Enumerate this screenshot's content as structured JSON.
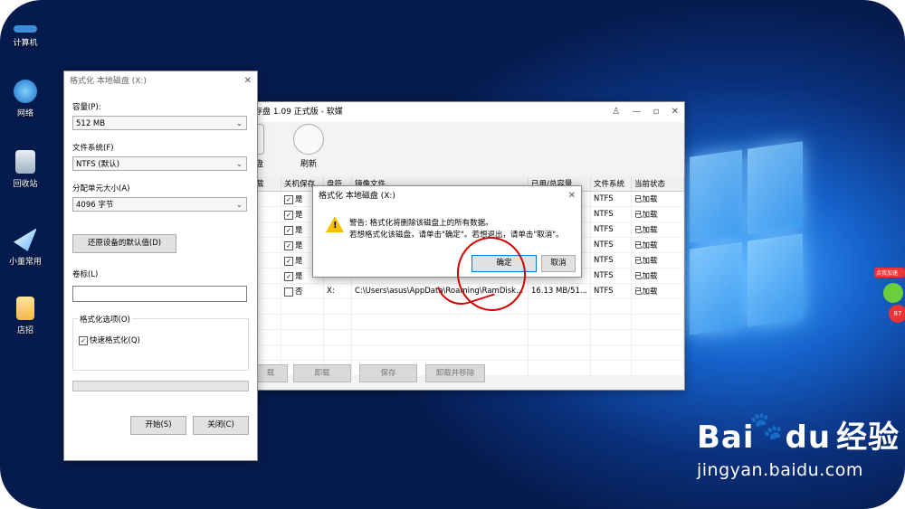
{
  "desktop": {
    "icons": [
      {
        "label": "计算机"
      },
      {
        "label": "网络"
      },
      {
        "label": "回收站"
      },
      {
        "label": "小董常用"
      },
      {
        "label": "店招"
      }
    ],
    "widget_label": "点我加速",
    "widget_value": "87"
  },
  "watermark": {
    "brand": "Bai",
    "brand2": "du",
    "brand_cn": "经验",
    "url": "jingyan.baidu.com"
  },
  "ramdisk": {
    "title": "内存盘 1.09 正式版 - 软媒",
    "toolbar": [
      {
        "label": "存盘"
      },
      {
        "label": "刷新"
      }
    ],
    "columns": [
      "载",
      "关机保存",
      "盘符",
      "镜像文件",
      "已用/总容量",
      "文件系统",
      "当前状态"
    ],
    "rows": [
      {
        "save": "是",
        "letter": "",
        "file": "",
        "used": "",
        "fs": "NTFS",
        "state": "已加载",
        "checked": true
      },
      {
        "save": "是",
        "letter": "",
        "file": "",
        "used": "",
        "fs": "NTFS",
        "state": "已加载",
        "checked": true
      },
      {
        "save": "是",
        "letter": "",
        "file": "",
        "used": "",
        "fs": "NTFS",
        "state": "已加载",
        "checked": true
      },
      {
        "save": "是",
        "letter": "",
        "file": "",
        "used": "",
        "fs": "NTFS",
        "state": "已加载",
        "checked": true
      },
      {
        "save": "是",
        "letter": "",
        "file": "",
        "used": "",
        "fs": "NTFS",
        "state": "已加载",
        "checked": true
      },
      {
        "save": "是",
        "letter": "",
        "file": "",
        "used": "",
        "fs": "NTFS",
        "state": "已加载",
        "checked": true
      },
      {
        "save": "否",
        "letter": "X:",
        "file": "C:\\Users\\asus\\AppData\\Roaming\\RamDisk...",
        "used": "16.13 MB/51...",
        "fs": "NTFS",
        "state": "已加载",
        "checked": false
      }
    ],
    "buttons": [
      "载",
      "卸载",
      "保存",
      "卸载并移除"
    ]
  },
  "format": {
    "title": "格式化 本地磁盘 (X:)",
    "capacity_label": "容量(P):",
    "capacity_value": "512 MB",
    "fs_label": "文件系统(F)",
    "fs_value": "NTFS (默认)",
    "unit_label": "分配单元大小(A)",
    "unit_value": "4096 字节",
    "restore_button": "还原设备的默认值(D)",
    "volume_label": "卷标(L)",
    "volume_value": "",
    "options_label": "格式化选项(O)",
    "quick_format": "快速格式化(Q)",
    "start_button": "开始(S)",
    "close_button": "关闭(C)"
  },
  "confirm": {
    "title": "格式化 本地磁盘 (X:)",
    "line1": "警告: 格式化将删除该磁盘上的所有数据。",
    "line2": "若想格式化该磁盘，请单击\"确定\"。若想退出，请单击\"取消\"。",
    "ok": "确定",
    "cancel": "取消"
  }
}
